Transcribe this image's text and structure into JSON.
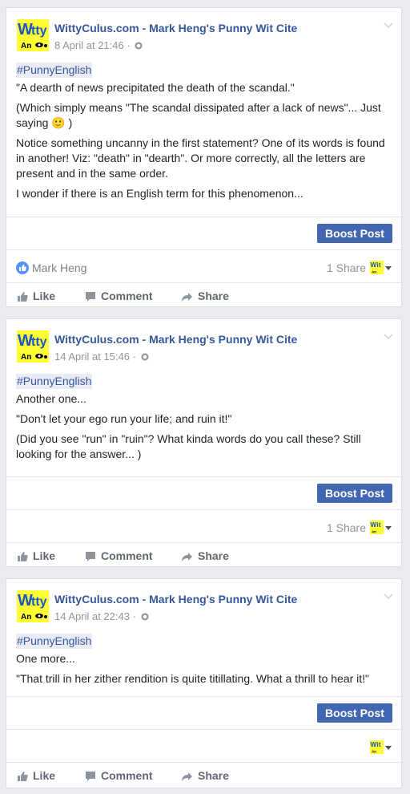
{
  "page": {
    "name": "WittyCulus.com - Mark Heng's Punny Wit Cite"
  },
  "buttons": {
    "boost": "Boost Post",
    "like": "Like",
    "comment": "Comment",
    "share": "Share"
  },
  "posts": [
    {
      "date": "8 April at 21:46 ·",
      "hashtag": "#PunnyEnglish",
      "paragraphs": [
        "\"A dearth of news precipitated the death of the scandal.\"",
        "(Which simply means \"The scandal dissipated after a lack of news\"... Just saying 🙂 )",
        "Notice something uncanny in the first statement? One of its words is found in another! Viz: \"death\" in \"dearth\". Or more correctly, all the letters are present and in the same order.",
        "I wonder if there is an English term for this phenomenon..."
      ],
      "liker": "Mark Heng",
      "shares": "1 Share"
    },
    {
      "date": "14 April at 15:46 ·",
      "hashtag": "#PunnyEnglish",
      "paragraphs": [
        "Another one...",
        "\"Don't let your ego run your life; and ruin it!\"",
        "(Did you see \"run\" in \"ruin\"? What kinda words do you call these? Still looking for the answer... )"
      ],
      "liker": "",
      "shares": "1 Share"
    },
    {
      "date": "14 April at 22:43 ·",
      "hashtag": "#PunnyEnglish",
      "paragraphs": [
        "One more...",
        "\"That trill in her zither rendition is quite titillating. What a thrill to hear it!\""
      ],
      "liker": "",
      "shares": ""
    }
  ],
  "icons": {
    "avatar": "wittyculus-logo",
    "globe": "globe-icon",
    "like": "thumbs-up-icon",
    "comment": "comment-icon",
    "share": "share-arrow-icon"
  },
  "colors": {
    "link": "#365899",
    "boost": "#4267b2",
    "hashtag_bg": "#e9ebf5"
  }
}
